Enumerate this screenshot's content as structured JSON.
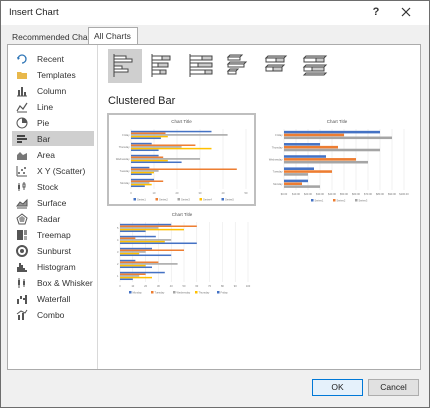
{
  "window": {
    "title": "Insert Chart",
    "help_label": "?"
  },
  "tabs": [
    {
      "label": "Recommended Charts"
    },
    {
      "label": "All Charts"
    }
  ],
  "sidebar": {
    "items": [
      {
        "label": "Recent",
        "icon": "recent-icon"
      },
      {
        "label": "Templates",
        "icon": "folder-icon"
      },
      {
        "label": "Column",
        "icon": "column-chart-icon"
      },
      {
        "label": "Line",
        "icon": "line-chart-icon"
      },
      {
        "label": "Pie",
        "icon": "pie-chart-icon"
      },
      {
        "label": "Bar",
        "icon": "bar-chart-icon",
        "selected": true
      },
      {
        "label": "Area",
        "icon": "area-chart-icon"
      },
      {
        "label": "X Y (Scatter)",
        "icon": "scatter-chart-icon"
      },
      {
        "label": "Stock",
        "icon": "stock-chart-icon"
      },
      {
        "label": "Surface",
        "icon": "surface-chart-icon"
      },
      {
        "label": "Radar",
        "icon": "radar-chart-icon"
      },
      {
        "label": "Treemap",
        "icon": "treemap-chart-icon"
      },
      {
        "label": "Sunburst",
        "icon": "sunburst-chart-icon"
      },
      {
        "label": "Histogram",
        "icon": "histogram-chart-icon"
      },
      {
        "label": "Box & Whisker",
        "icon": "box-whisker-chart-icon"
      },
      {
        "label": "Waterfall",
        "icon": "waterfall-chart-icon"
      },
      {
        "label": "Combo",
        "icon": "combo-chart-icon"
      }
    ]
  },
  "subtypes": [
    "Clustered Bar",
    "Stacked Bar",
    "100% Stacked Bar",
    "3-D Clustered Bar",
    "3-D Stacked Bar",
    "3-D 100% Stacked Bar"
  ],
  "selected_subtype_name": "Clustered Bar",
  "colors": {
    "blue": "#4472c4",
    "orange": "#ed7d31",
    "gray": "#a5a5a5",
    "gold": "#ffc000",
    "selection": "#cfcfcf",
    "ok_border": "#0078d7"
  },
  "chart_data": [
    {
      "type": "bar",
      "title": "Chart Title",
      "categories": [
        "Monday",
        "Tuesday",
        "Wednesday",
        "Thursday",
        "Friday"
      ],
      "series": [
        {
          "name": "Series1",
          "values": [
            10,
            8,
            12,
            9,
            35
          ]
        },
        {
          "name": "Series2",
          "values": [
            14,
            46,
            14,
            28,
            15
          ]
        },
        {
          "name": "Series3",
          "values": [
            8,
            12,
            30,
            22,
            42
          ]
        },
        {
          "name": "Series4",
          "values": [
            9,
            10,
            16,
            35,
            16
          ]
        },
        {
          "name": "Series5",
          "values": [
            6,
            9,
            22,
            12,
            13
          ]
        }
      ],
      "xlim": [
        0,
        50
      ],
      "xticks": [
        "0",
        "10",
        "20",
        "30",
        "40",
        "50"
      ],
      "legend": "bottom"
    },
    {
      "type": "bar",
      "title": "Chart Title",
      "categories": [
        "Monday",
        "Tuesday",
        "Wednesday",
        "Thursday",
        "Friday"
      ],
      "series": [
        {
          "name": "Series1",
          "values": [
            20,
            25,
            35,
            30,
            80
          ]
        },
        {
          "name": "Series2",
          "values": [
            15,
            40,
            60,
            45,
            50
          ]
        },
        {
          "name": "Series3",
          "values": [
            30,
            20,
            70,
            80,
            90
          ]
        }
      ],
      "xlim": [
        0,
        100
      ],
      "xticks": [
        "$0.00",
        "$10.00",
        "$20.00",
        "$30.00",
        "$40.00",
        "$50.00",
        "$60.00",
        "$70.00",
        "$80.00",
        "$90.00",
        "$100.00"
      ],
      "legend": "bottom"
    },
    {
      "type": "bar",
      "title": "Chart Title",
      "categories": [
        "1",
        "2",
        "3",
        "4",
        "5"
      ],
      "series": [
        {
          "name": "Monday",
          "values": [
            35,
            12,
            25,
            28,
            40
          ]
        },
        {
          "name": "Tuesday",
          "values": [
            20,
            30,
            50,
            12,
            60
          ]
        },
        {
          "name": "Wednesday",
          "values": [
            15,
            45,
            20,
            40,
            30
          ]
        },
        {
          "name": "Thursday",
          "values": [
            25,
            20,
            15,
            35,
            50
          ]
        },
        {
          "name": "Friday",
          "values": [
            10,
            25,
            40,
            60,
            20
          ]
        }
      ],
      "xlim": [
        0,
        100
      ],
      "xticks": [
        "0",
        "10",
        "20",
        "30",
        "40",
        "50",
        "60",
        "70",
        "80",
        "90",
        "100"
      ],
      "legend": "bottom"
    }
  ],
  "footer": {
    "ok_label": "OK",
    "cancel_label": "Cancel"
  }
}
